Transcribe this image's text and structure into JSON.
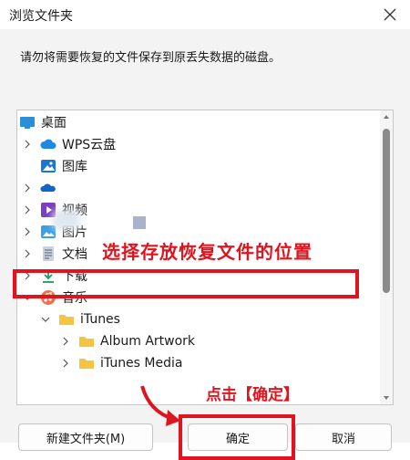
{
  "window": {
    "title": "浏览文件夹"
  },
  "instruction": "请勿将需要恢复的文件保存到原丢失数据的磁盘。",
  "tree": [
    {
      "label": "桌面",
      "icon": "desktop-icon",
      "expander": "none"
    },
    {
      "label": "WPS云盘",
      "icon": "cloud-icon",
      "expander": "collapsed"
    },
    {
      "label": "图库",
      "icon": "gallery-icon",
      "expander": "none"
    },
    {
      "label": "",
      "icon": "onedrive-cloud-icon",
      "expander": "collapsed"
    },
    {
      "label": "视频",
      "icon": "video-icon",
      "expander": "collapsed"
    },
    {
      "label": "图片",
      "icon": "pictures-icon",
      "expander": "collapsed"
    },
    {
      "label": "文档",
      "icon": "documents-icon",
      "expander": "collapsed"
    },
    {
      "label": "下载",
      "icon": "download-icon",
      "expander": "collapsed"
    },
    {
      "label": "音乐",
      "icon": "music-icon",
      "expander": "expanded"
    },
    {
      "label": "iTunes",
      "icon": "folder-icon",
      "expander": "expanded"
    },
    {
      "label": "Album Artwork",
      "icon": "folder-icon",
      "expander": "collapsed"
    },
    {
      "label": "iTunes Media",
      "icon": "folder-icon",
      "expander": "collapsed"
    }
  ],
  "annotations": {
    "select_location": "选择存放恢复文件的位置",
    "click_ok": "点击【确定】"
  },
  "buttons": {
    "new_folder": "新建文件夹(M)",
    "ok": "确定",
    "cancel": "取消"
  },
  "colors": {
    "annotation_red": "#e0141e",
    "dialog_bg": "#f3f3f3",
    "folder_yellow": "#f5c542"
  }
}
